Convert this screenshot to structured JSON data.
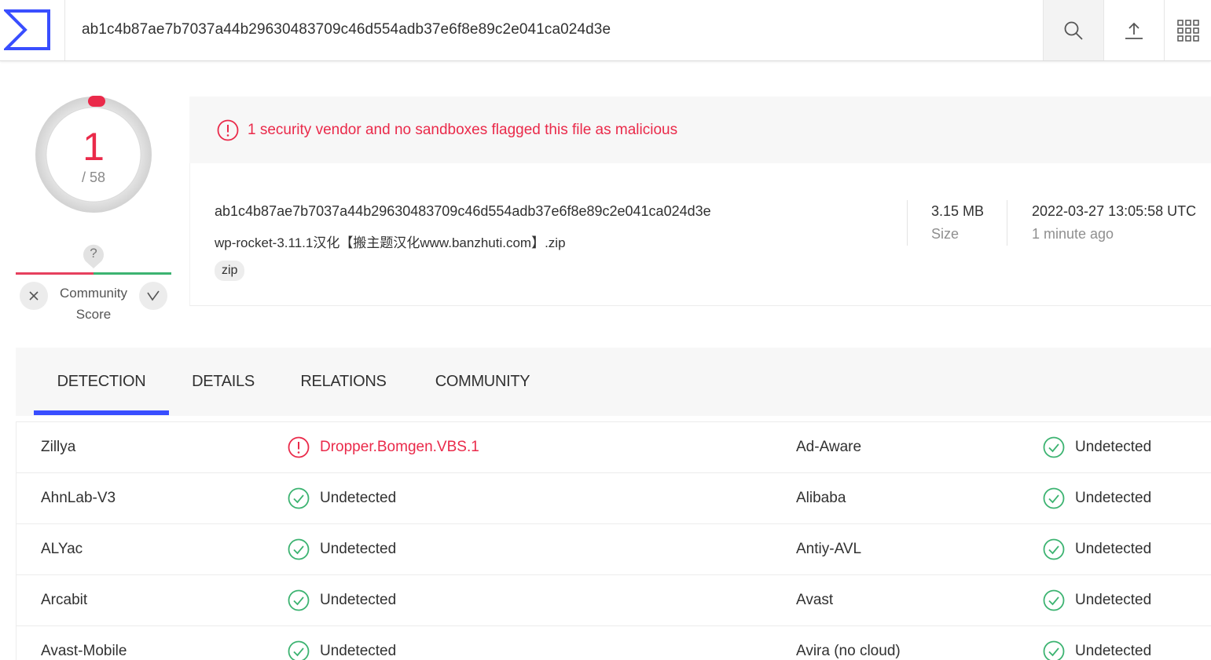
{
  "search": {
    "query": "ab1c4b87ae7b7037a44b29630483709c46d554adb37e6f8e89c2e041ca024d3e"
  },
  "score": {
    "detections": "1",
    "total": "/ 58"
  },
  "community": {
    "question": "?",
    "label_line1": "Community",
    "label_line2": "Score"
  },
  "alert": {
    "text": "1 security vendor and no sandboxes flagged this file as malicious"
  },
  "file": {
    "hash": "ab1c4b87ae7b7037a44b29630483709c46d554adb37e6f8e89c2e041ca024d3e",
    "name": "wp-rocket-3.11.1汉化【搬主题汉化www.banzhuti.com】.zip",
    "tag": "zip",
    "size": "3.15 MB",
    "size_label": "Size",
    "date": "2022-03-27 13:05:58 UTC",
    "ago": "1 minute ago"
  },
  "tabs": [
    {
      "label": "DETECTION",
      "active": true
    },
    {
      "label": "DETAILS",
      "active": false
    },
    {
      "label": "RELATIONS",
      "active": false
    },
    {
      "label": "COMMUNITY",
      "active": false
    }
  ],
  "detections": [
    {
      "vendor1": "Zillya",
      "result1": "Dropper.Bomgen.VBS.1",
      "malicious1": true,
      "vendor2": "Ad-Aware",
      "result2": "Undetected",
      "malicious2": false
    },
    {
      "vendor1": "AhnLab-V3",
      "result1": "Undetected",
      "malicious1": false,
      "vendor2": "Alibaba",
      "result2": "Undetected",
      "malicious2": false
    },
    {
      "vendor1": "ALYac",
      "result1": "Undetected",
      "malicious1": false,
      "vendor2": "Antiy-AVL",
      "result2": "Undetected",
      "malicious2": false
    },
    {
      "vendor1": "Arcabit",
      "result1": "Undetected",
      "malicious1": false,
      "vendor2": "Avast",
      "result2": "Undetected",
      "malicious2": false
    },
    {
      "vendor1": "Avast-Mobile",
      "result1": "Undetected",
      "malicious1": false,
      "vendor2": "Avira (no cloud)",
      "result2": "Undetected",
      "malicious2": false
    }
  ],
  "colors": {
    "malicious": "#ea2a4a",
    "clean": "#3cb371",
    "accent": "#394eff"
  }
}
